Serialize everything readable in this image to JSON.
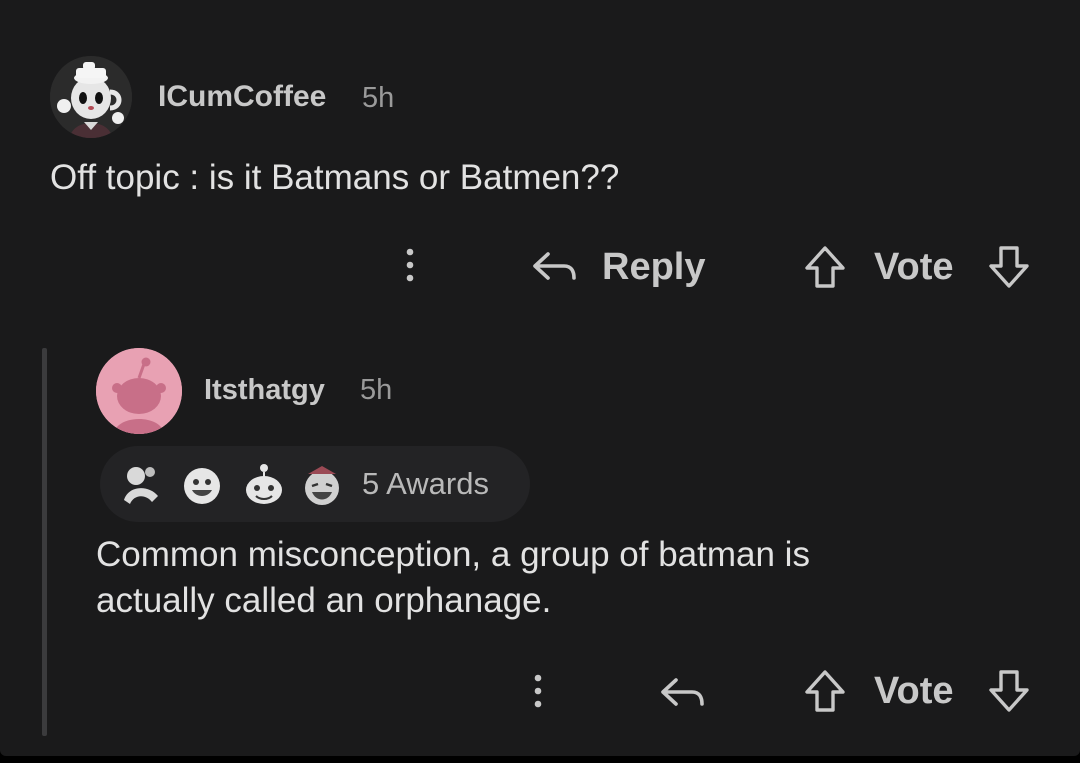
{
  "top_comment": {
    "username": "ICumCoffee",
    "time": "5h",
    "body": "Off topic : is it Batmans or Batmen??",
    "actions": {
      "reply_label": "Reply",
      "vote_label": "Vote"
    }
  },
  "reply_comment": {
    "username": "Itsthatgy",
    "time": "5h",
    "awards_label": "5 Awards",
    "body_lines": [
      "Common misconception, a group of batman is",
      "actually called an orphanage."
    ],
    "actions": {
      "vote_label": "Vote"
    }
  },
  "colors": {
    "background": "#1a1a1b",
    "text_primary": "#e2e2e2",
    "text_secondary": "#c8c8c8",
    "avatar_reply": "#e8a1b3"
  }
}
